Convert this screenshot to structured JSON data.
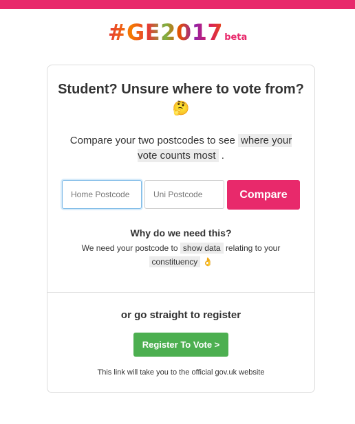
{
  "colors": {
    "accent": "#e8296b",
    "register": "#4caf50"
  },
  "logo": {
    "main": "#GE2017",
    "beta": "beta"
  },
  "card": {
    "title": "Student? Unsure where to vote from?",
    "title_emoji": "🤔",
    "desc_before": "Compare your two postcodes to see",
    "desc_highlight": "where your vote counts most",
    "desc_after": ".",
    "home_placeholder": "Home Postcode",
    "uni_placeholder": "Uni Postcode",
    "compare_label": "Compare",
    "why_title": "Why do we need this?",
    "why_before": "We need your postcode to",
    "why_highlight1": "show data",
    "why_mid": "relating to your",
    "why_highlight2": "constituency",
    "why_emoji": "👌",
    "or_text": "or go straight to register",
    "register_label": "Register To Vote >",
    "note": "This link will take you to the official gov.uk website"
  }
}
